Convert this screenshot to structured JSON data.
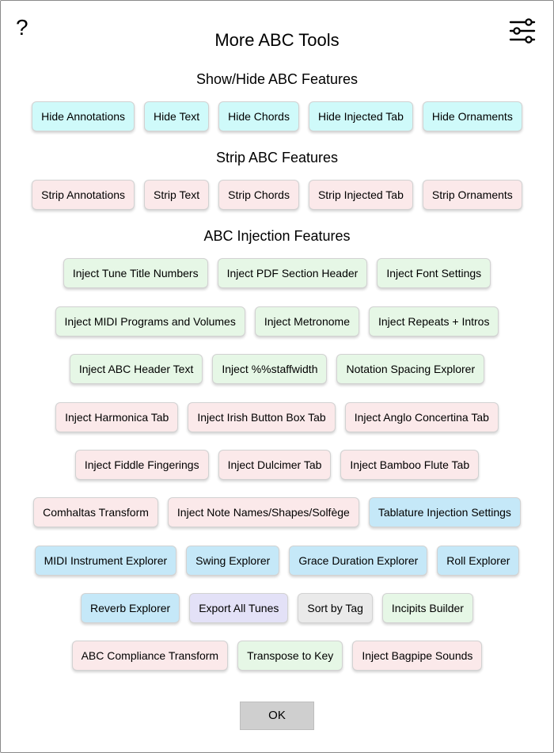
{
  "dialog": {
    "help_label": "?",
    "title": "More ABC Tools",
    "settings_icon": "sliders-icon",
    "ok_label": "OK"
  },
  "colors": {
    "hide": "#cffafa",
    "strip": "#fbe9ea",
    "inject_green": "#e6f7e6",
    "inject_pink": "#fbe9ea",
    "explorer_blue": "#c5e8f8",
    "export_lavender": "#e3e1f7",
    "sort_gray": "#eaeaea"
  },
  "sections": {
    "show_hide": {
      "heading": "Show/Hide ABC Features",
      "buttons": [
        "Hide Annotations",
        "Hide Text",
        "Hide Chords",
        "Hide Injected Tab",
        "Hide Ornaments"
      ]
    },
    "strip": {
      "heading": "Strip ABC Features",
      "buttons": [
        "Strip Annotations",
        "Strip Text",
        "Strip Chords",
        "Strip Injected Tab",
        "Strip Ornaments"
      ]
    },
    "injection": {
      "heading": "ABC Injection Features",
      "rows": [
        [
          "Inject Tune Title Numbers",
          "Inject PDF Section Header",
          "Inject Font Settings"
        ],
        [
          "Inject MIDI Programs and Volumes",
          "Inject Metronome",
          "Inject Repeats + Intros"
        ],
        [
          "Inject ABC Header Text",
          "Inject %%staffwidth",
          "Notation Spacing Explorer"
        ],
        [
          "Inject Harmonica Tab",
          "Inject Irish Button Box Tab",
          "Inject Anglo Concertina Tab"
        ],
        [
          "Inject Fiddle Fingerings",
          "Inject Dulcimer Tab",
          "Inject Bamboo Flute Tab"
        ],
        [
          "Comhaltas Transform",
          "Inject Note Names/Shapes/Solfège",
          "Tablature Injection Settings"
        ],
        [
          "MIDI Instrument Explorer",
          "Swing Explorer",
          "Grace Duration Explorer",
          "Roll Explorer"
        ],
        [
          "Reverb Explorer",
          "Export All Tunes",
          "Sort by Tag",
          "Incipits Builder"
        ],
        [
          "ABC Compliance Transform",
          "Transpose to Key",
          "Inject Bagpipe Sounds"
        ]
      ]
    }
  }
}
